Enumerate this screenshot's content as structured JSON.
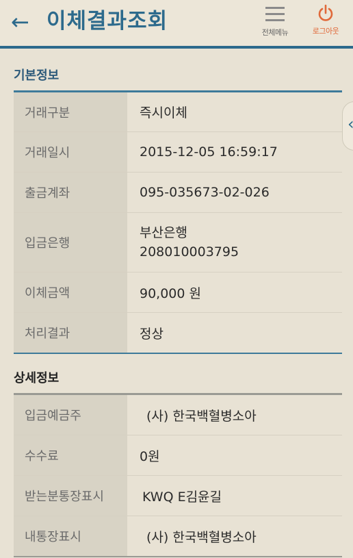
{
  "header": {
    "title": "이체결과조회",
    "menu_label": "전체메뉴",
    "logout_label": "로그아웃"
  },
  "basic_info": {
    "section_title": "기본정보",
    "rows": [
      {
        "label": "거래구분",
        "value": "즉시이체"
      },
      {
        "label": "거래일시",
        "value": "2015-12-05 16:59:17"
      },
      {
        "label": "출금계좌",
        "value": "095-035673-02-026"
      },
      {
        "label": "입금은행",
        "value": "부산은행",
        "value2": "208010003795"
      },
      {
        "label": "이체금액",
        "value": "90,000 원"
      },
      {
        "label": "처리결과",
        "value": "정상"
      }
    ]
  },
  "detail_info": {
    "section_title": "상세정보",
    "rows": [
      {
        "label": "입금예금주",
        "value": "(사) 한국백혈병소아"
      },
      {
        "label": "수수료",
        "value": "0원"
      },
      {
        "label": "받는분통장표시",
        "value": "KWQ E김윤길"
      },
      {
        "label": "내통장표시",
        "value": "(사) 한국백혈병소아"
      }
    ]
  },
  "icons": {
    "back": "back-arrow-icon",
    "menu": "hamburger-menu-icon",
    "logout": "power-icon",
    "side_tab": "chevron-left-icon"
  },
  "colors": {
    "accent": "#2d6a8c",
    "logout": "#e0693a",
    "background": "#e8e2d4",
    "label_cell": "#d8d3c5"
  }
}
